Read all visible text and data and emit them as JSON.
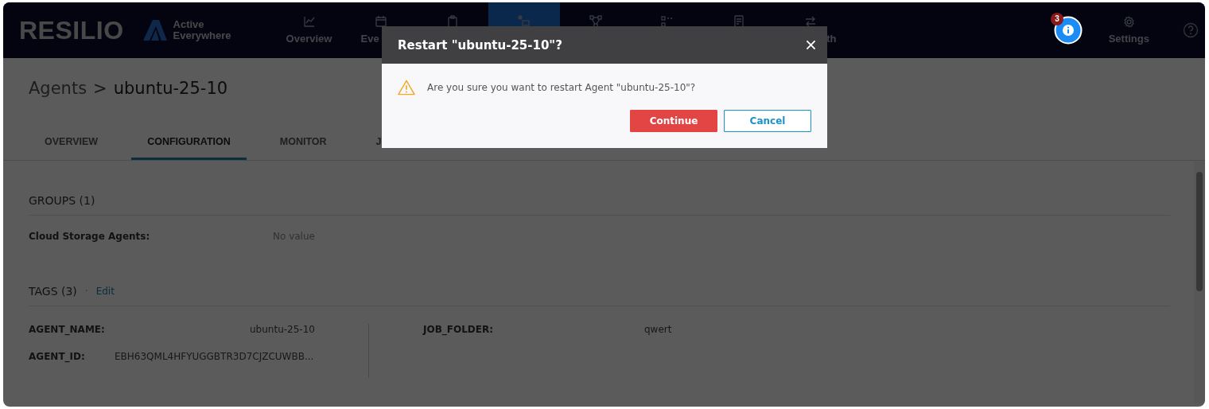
{
  "header": {
    "brand": "RESILIO",
    "product": [
      "Active",
      "Everywhere"
    ],
    "nav": [
      {
        "label": "Overview",
        "kind": "chart",
        "selected": false
      },
      {
        "label": "Eve",
        "kind": "calendar",
        "selected": false
      },
      {
        "kind": "clipboard",
        "selected": false
      },
      {
        "kind": "agent",
        "selected": true
      },
      {
        "kind": "nodes",
        "selected": false
      },
      {
        "kind": "grid",
        "selected": false
      },
      {
        "kind": "report",
        "selected": false
      },
      {
        "label": "th",
        "kind": "arrows",
        "selected": false
      }
    ],
    "notifications": {
      "count": "3"
    },
    "settings": "Settings"
  },
  "breadcrumb": {
    "parent": "Agents",
    "separator": ">",
    "current": "ubuntu-25-10"
  },
  "tabs": [
    {
      "label": "OVERVIEW",
      "selected": false
    },
    {
      "label": "CONFIGURATION",
      "selected": true
    },
    {
      "label": "MONITOR",
      "selected": false
    },
    {
      "label": "J",
      "selected": false
    }
  ],
  "groups": {
    "title": "GROUPS (1)",
    "rows": [
      {
        "label": "Cloud Storage Agents:",
        "value": "No value"
      }
    ]
  },
  "tags": {
    "title": "TAGS (3)",
    "separator": "·",
    "edit": "Edit",
    "left": [
      {
        "label": "AGENT_NAME:",
        "value": "ubuntu-25-10",
        "kind": "right"
      },
      {
        "label": "AGENT_ID:",
        "value": "EBH63QML4HFYUGGBTR3D7CJZCUWBB...",
        "kind": "near"
      }
    ],
    "right": [
      {
        "label": "JOB_FOLDER:",
        "value": "qwert"
      }
    ]
  },
  "dialog": {
    "title": "Restart \"ubuntu-25-10\"?",
    "message": "Are you sure you want to restart Agent \"ubuntu-25-10\"?",
    "buttons": [
      {
        "label": "Continue",
        "kind": "primary"
      },
      {
        "label": "Cancel",
        "kind": "secondary"
      }
    ]
  }
}
